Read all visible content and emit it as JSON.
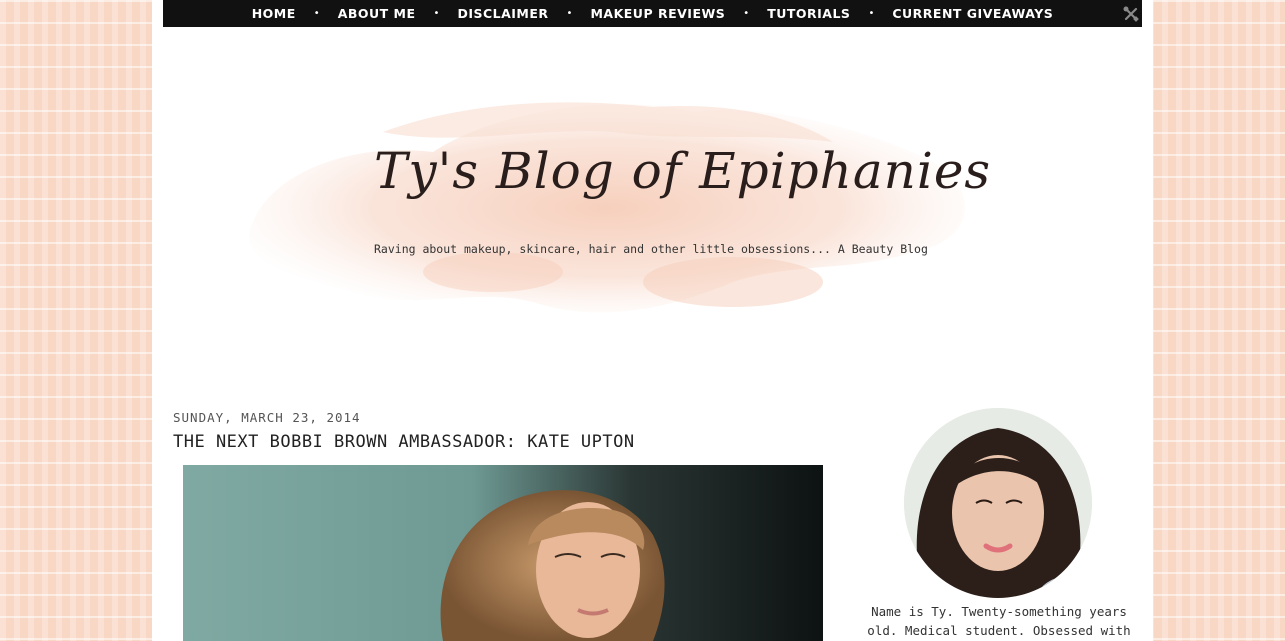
{
  "nav": {
    "items": [
      {
        "label": "HOME"
      },
      {
        "label": "ABOUT ME"
      },
      {
        "label": "DISCLAIMER"
      },
      {
        "label": "MAKEUP REVIEWS"
      },
      {
        "label": "TUTORIALS"
      },
      {
        "label": "CURRENT GIVEAWAYS"
      }
    ],
    "separator": "•",
    "tools_icon": "wrench-screwdriver-icon"
  },
  "header": {
    "title": "Ty's Blog of Epiphanies",
    "description": "Raving about makeup, skincare, hair and other little obsessions... A Beauty Blog"
  },
  "post": {
    "date": "SUNDAY, MARCH 23, 2014",
    "title": "THE NEXT BOBBI BROWN AMBASSADOR: KATE UPTON"
  },
  "sidebar": {
    "bio_line1": "Name is Ty. Twenty-something years",
    "bio_line2": "old. Medical student. Obsessed with"
  },
  "colors": {
    "background": "#f8d7c4",
    "navbar": "#111111",
    "splash": "#f7d3c2",
    "text": "#222222"
  }
}
